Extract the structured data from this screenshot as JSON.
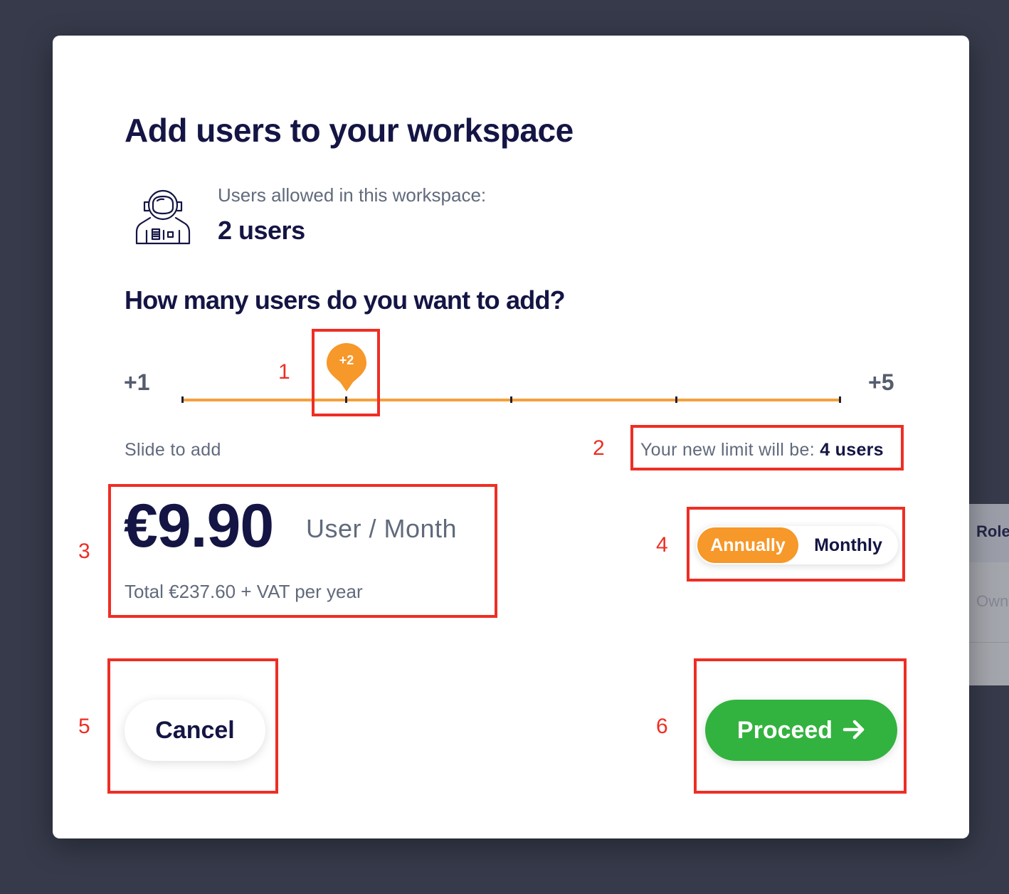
{
  "background": {
    "table_header": "Role",
    "table_cell": "Owner"
  },
  "modal": {
    "title": "Add users to your workspace",
    "allowed_label": "Users allowed in this workspace:",
    "allowed_value": "2 users",
    "question": "How many users do you want to add?",
    "slider": {
      "min_label": "+1",
      "max_label": "+5",
      "value_label": "+2",
      "value": 2,
      "min": 1,
      "max": 5,
      "hint": "Slide to add"
    },
    "new_limit_label": "Your new limit will be:",
    "new_limit_value": "4 users",
    "price": "€9.90",
    "price_unit": "User / Month",
    "price_total": "Total €237.60 + VAT per year",
    "billing_toggle": {
      "options": [
        "Annually",
        "Monthly"
      ],
      "selected": "Annually"
    },
    "cancel_label": "Cancel",
    "proceed_label": "Proceed"
  },
  "annotations": [
    "1",
    "2",
    "3",
    "4",
    "5",
    "6"
  ],
  "colors": {
    "accent_orange": "#f6982a",
    "proceed_green": "#32b33f",
    "heading_navy": "#141544",
    "annotation_red": "#ee2e24",
    "overlay": "#363a4a"
  },
  "icons": {
    "astronaut": "astronaut-icon",
    "proceed_arrow": "arrow-right-icon"
  }
}
